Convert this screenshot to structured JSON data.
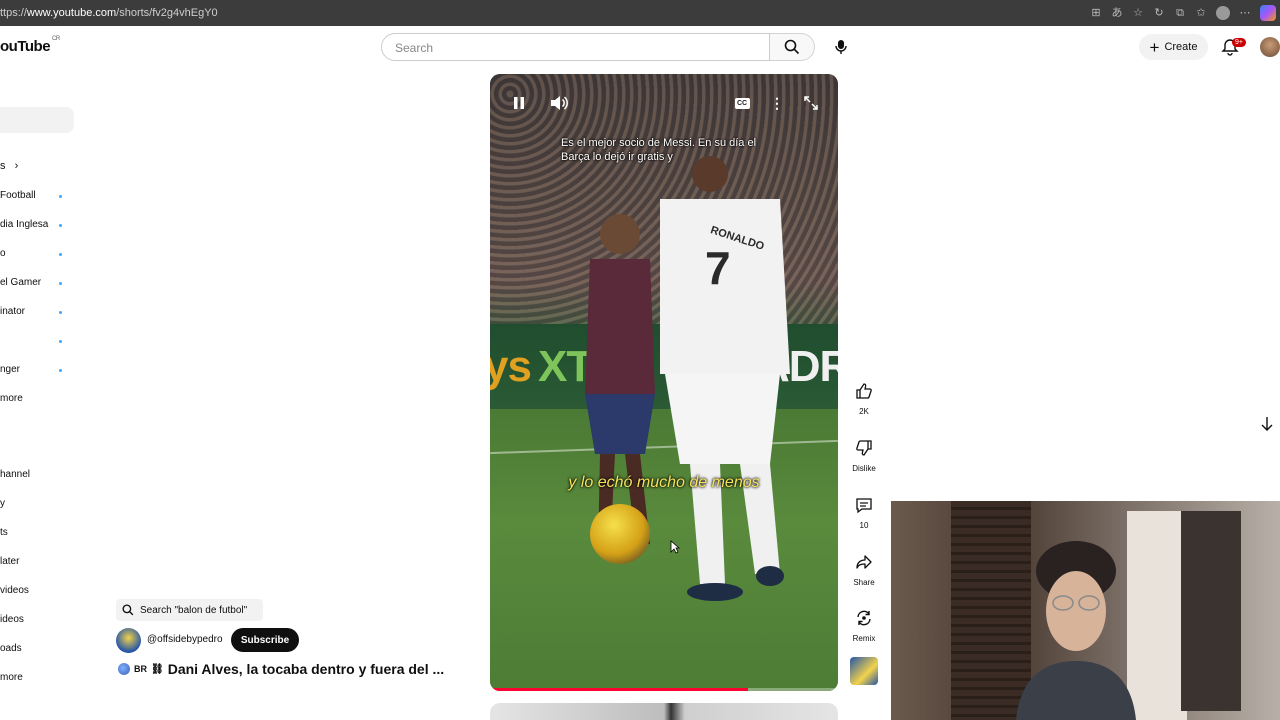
{
  "browser": {
    "url_prefix": "ttps://",
    "url_host": "www.youtube.com",
    "url_path": "/shorts/fv2g4vhEgY0"
  },
  "header": {
    "logo_text": "ouTube",
    "logo_region": "CR",
    "search_placeholder": "Search",
    "create_label": "Create",
    "notifications_badge": "9+"
  },
  "sidebar": {
    "subscriptions_heading": "s",
    "subscriptions": [
      {
        "label": "Football",
        "new": true
      },
      {
        "label": "dia Inglesa",
        "new": true
      },
      {
        "label": "o",
        "new": true
      },
      {
        "label": "el Gamer",
        "new": true
      },
      {
        "label": "inator",
        "new": true
      },
      {
        "label": "",
        "new": true
      },
      {
        "label": "nger",
        "new": true
      }
    ],
    "show_more_1": "more",
    "you_items": [
      "hannel",
      "y",
      "ts",
      "later",
      "videos",
      "ideos",
      "oads",
      "more"
    ]
  },
  "video": {
    "caption_top": "Es el mejor socio de Messi. En su día el Barça lo dejó ir gratis y",
    "caption_mid": "y lo echó mucho de menos",
    "banner_left": "ys",
    "banner_mid": "XTR",
    "banner_right": "ADR",
    "shirt_name": "RONALDO",
    "shirt_number": "7",
    "cc_label": "CC",
    "progress": 0.74
  },
  "overlay": {
    "search_suggestion": "Search \"balon de futbol\"",
    "channel_handle": "@offsidebypedro",
    "subscribe_label": "Subscribe",
    "flag_label": "BR",
    "title": "Dani Alves, la tocaba dentro y fuera del ..."
  },
  "actions": {
    "like_count": "2K",
    "dislike_label": "Dislike",
    "comments_count": "10",
    "share_label": "Share",
    "remix_label": "Remix"
  }
}
